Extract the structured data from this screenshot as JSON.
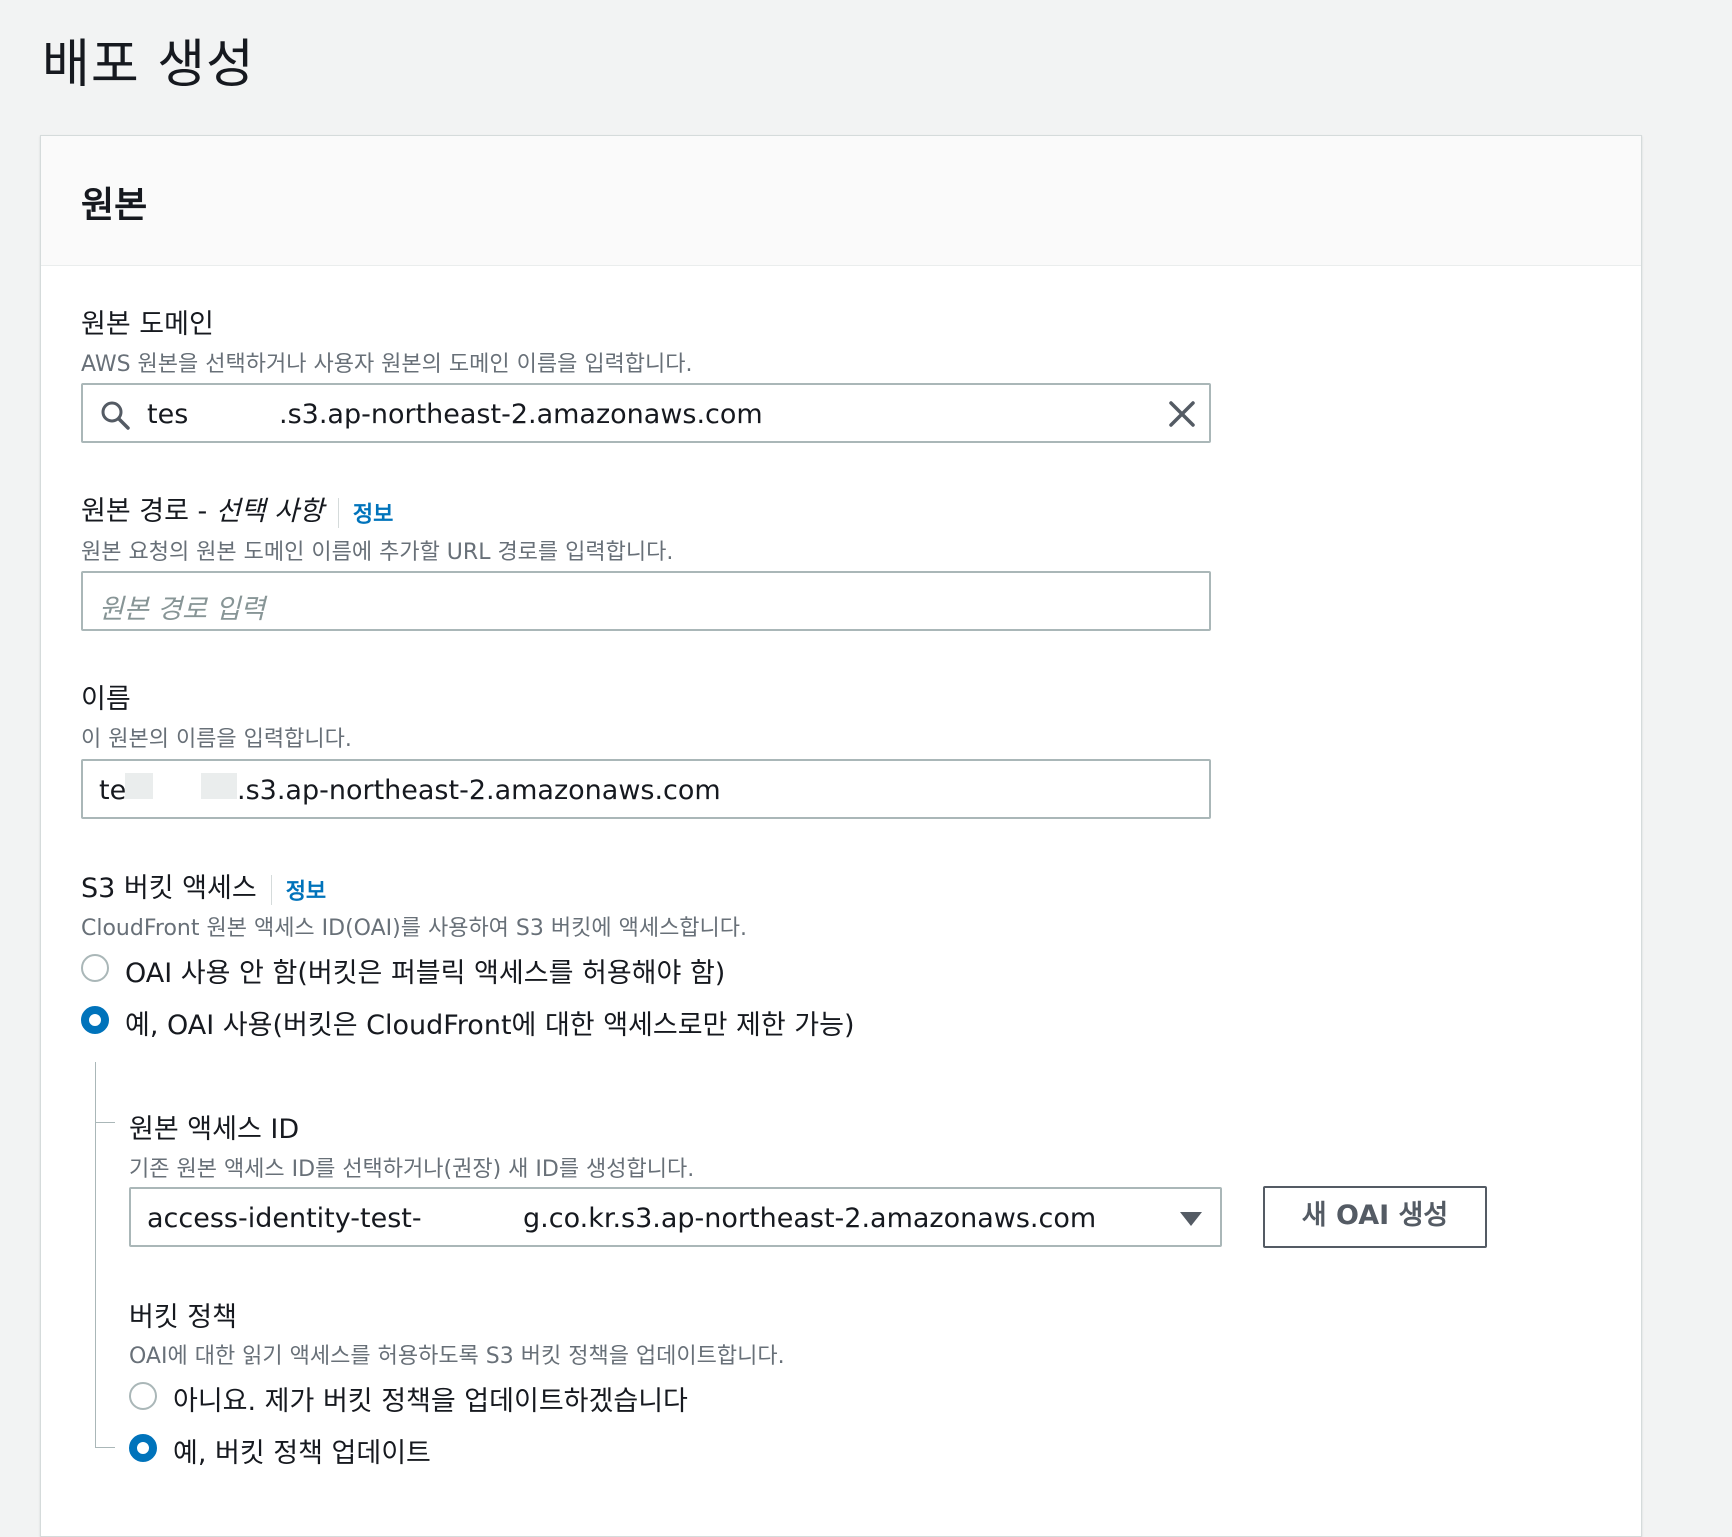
{
  "page": {
    "title": "배포 생성"
  },
  "origin_panel": {
    "title": "원본",
    "origin_domain": {
      "label": "원본 도메인",
      "description": "AWS 원본을 선택하거나 사용자 원본의 도메인 이름을 입력합니다.",
      "value_start": "tes",
      "value_end": ".s3.ap-northeast-2.amazonaws.com"
    },
    "origin_path": {
      "label": "원본 경로 -",
      "optional_label": "선택 사항",
      "info_link": "정보",
      "description": "원본 요청의 원본 도메인 이름에 추가할 URL 경로를 입력합니다.",
      "placeholder": "원본 경로 입력"
    },
    "name": {
      "label": "이름",
      "description": "이 원본의 이름을 입력합니다.",
      "value_start": "te",
      "value_end": ".s3.ap-northeast-2.amazonaws.com"
    },
    "s3_bucket_access": {
      "label": "S3 버킷 액세스",
      "info_link": "정보",
      "description": "CloudFront 원본 액세스 ID(OAI)를 사용하여 S3 버킷에 액세스합니다.",
      "options": [
        {
          "label": "OAI 사용 안 함(버킷은 퍼블릭 액세스를 허용해야 함)",
          "selected": false
        },
        {
          "label": "예, OAI 사용(버킷은 CloudFront에 대한 액세스로만 제한 가능)",
          "selected": true
        }
      ]
    },
    "origin_access_id": {
      "label": "원본 액세스 ID",
      "description": "기존 원본 액세스 ID를 선택하거나(권장) 새 ID를 생성합니다.",
      "selected_value_start": "access-identity-test-",
      "selected_value_end": "g.co.kr.s3.ap-northeast-2.amazonaws.com",
      "create_button": "새 OAI 생성"
    },
    "bucket_policy": {
      "label": "버킷 정책",
      "description": "OAI에 대한 읽기 액세스를 허용하도록 S3 버킷 정책을 업데이트합니다.",
      "options": [
        {
          "label": "아니요. 제가 버킷 정책을 업데이트하겠습니다",
          "selected": false
        },
        {
          "label": "예, 버킷 정책 업데이트",
          "selected": true
        }
      ]
    }
  },
  "colors": {
    "link": "#0073bb",
    "radio_checked": "#0073bb",
    "border": "#aab7b8",
    "page_bg": "#f2f3f3"
  }
}
